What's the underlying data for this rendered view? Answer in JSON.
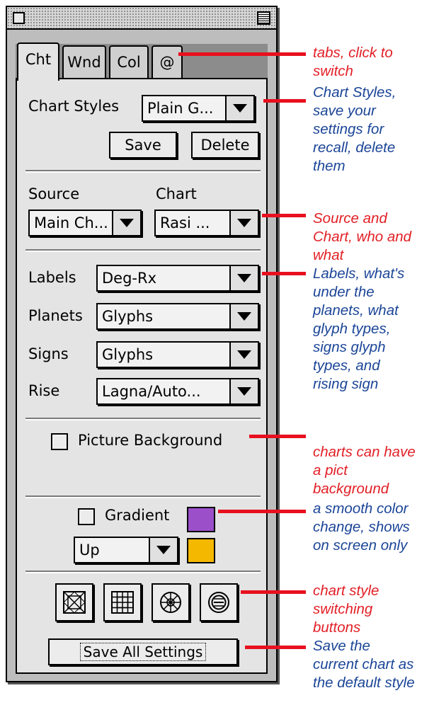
{
  "tabs": [
    "Cht",
    "Wnd",
    "Col",
    "@"
  ],
  "chart_styles": {
    "label": "Chart Styles",
    "selected": "Plain G...",
    "save_label": "Save",
    "delete_label": "Delete"
  },
  "source_chart": {
    "source_label": "Source",
    "chart_label": "Chart",
    "source_value": "Main Ch...",
    "chart_value": "Rasi ..."
  },
  "options": [
    {
      "label": "Labels",
      "value": "Deg-Rx"
    },
    {
      "label": "Planets",
      "value": "Glyphs"
    },
    {
      "label": "Signs",
      "value": "Glyphs"
    },
    {
      "label": "Rise",
      "value": "Lagna/Auto..."
    }
  ],
  "picture_background": {
    "label": "Picture Background",
    "checked": false
  },
  "gradient": {
    "label": "Gradient",
    "checked": false,
    "direction": "Up",
    "color_top": "#9b4fc9",
    "color_bottom": "#f5b800"
  },
  "style_buttons": [
    "south-indian-chart-icon",
    "grid-chart-icon",
    "wheel-chart-icon",
    "circle-chart-icon"
  ],
  "save_all_label": "Save All Settings",
  "annotations": {
    "tabs": {
      "red": [
        "tabs, click to",
        "switch"
      ],
      "blue": [
        "Chart Styles,",
        "save your",
        "settings for",
        "recall, delete",
        "them"
      ]
    },
    "source": {
      "red": [
        "Source and",
        "Chart, who and",
        "what"
      ],
      "blue": [
        "Labels, what's",
        "under the",
        "planets, what",
        "glyph types,",
        "signs glyph",
        "types, and",
        "rising sign"
      ]
    },
    "picture": {
      "red": [
        "charts can have",
        "a pict",
        "background"
      ],
      "blue": [
        "a smooth color",
        "change, shows",
        "on screen only"
      ]
    },
    "style": {
      "red": [
        "chart style",
        "switching",
        "buttons"
      ],
      "blue": [
        "Save the",
        "current chart as",
        "the default style"
      ]
    }
  },
  "colors": {
    "annotation_red": "#e21f26",
    "annotation_blue": "#1b4597"
  }
}
